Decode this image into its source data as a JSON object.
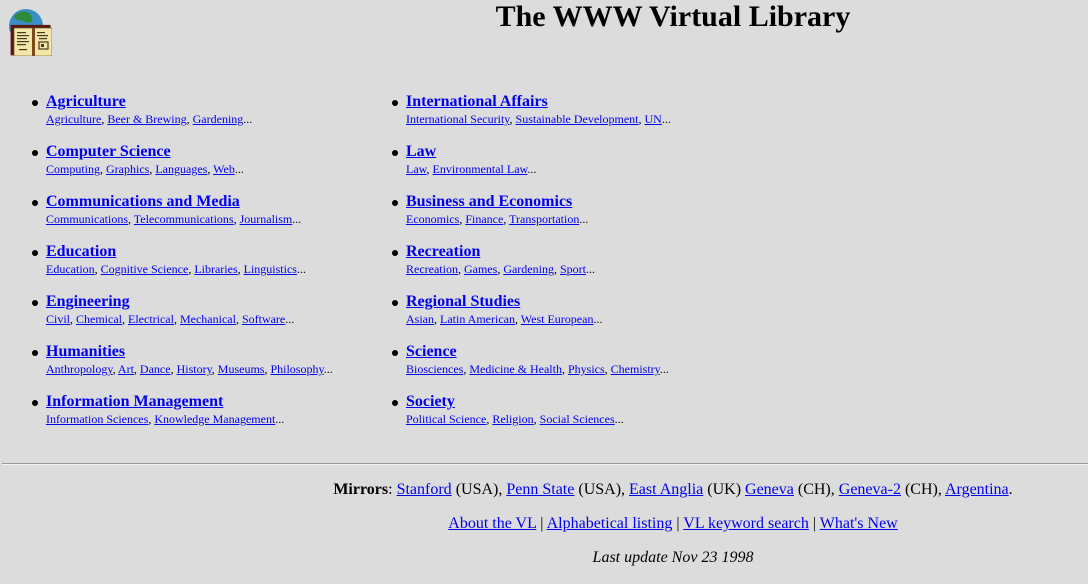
{
  "header": {
    "logo_icon": "globe-book-icon",
    "title": "The WWW Virtual Library"
  },
  "left_column": [
    {
      "title": "Agriculture",
      "subs": [
        "Agriculture",
        "Beer & Brewing",
        "Gardening"
      ]
    },
    {
      "title": "Computer Science",
      "subs": [
        "Computing",
        "Graphics",
        "Languages",
        "Web"
      ]
    },
    {
      "title": "Communications and Media",
      "subs": [
        "Communications",
        "Telecommunications",
        "Journalism"
      ]
    },
    {
      "title": "Education",
      "subs": [
        "Education",
        "Cognitive Science",
        "Libraries",
        "Linguistics"
      ]
    },
    {
      "title": "Engineering",
      "subs": [
        "Civil",
        "Chemical",
        "Electrical",
        "Mechanical",
        "Software"
      ]
    },
    {
      "title": "Humanities",
      "subs": [
        "Anthropology",
        "Art",
        "Dance",
        "History",
        "Museums",
        "Philosophy"
      ]
    },
    {
      "title": "Information Management",
      "subs": [
        "Information Sciences",
        "Knowledge Management"
      ]
    }
  ],
  "right_column": [
    {
      "title": "International Affairs",
      "subs": [
        "International Security",
        "Sustainable Development",
        "UN"
      ]
    },
    {
      "title": "Law",
      "subs": [
        "Law",
        "Environmental Law"
      ]
    },
    {
      "title": "Business and Economics",
      "subs": [
        "Economics",
        "Finance",
        "Transportation"
      ]
    },
    {
      "title": "Recreation",
      "subs": [
        "Recreation",
        "Games",
        "Gardening",
        "Sport"
      ]
    },
    {
      "title": "Regional Studies",
      "subs": [
        "Asian",
        "Latin American",
        "West European"
      ]
    },
    {
      "title": "Science",
      "subs": [
        "Biosciences",
        "Medicine & Health",
        "Physics",
        "Chemistry"
      ]
    },
    {
      "title": "Society",
      "subs": [
        "Political Science",
        "Religion",
        "Social Sciences"
      ]
    }
  ],
  "footer": {
    "mirrors_label": "Mirrors",
    "mirrors": [
      {
        "name": "Stanford",
        "country": "(USA)",
        "sep": ", "
      },
      {
        "name": "Penn State",
        "country": "(USA)",
        "sep": ", "
      },
      {
        "name": "East Anglia",
        "country": "(UK)",
        "sep": " "
      },
      {
        "name": "Geneva",
        "country": "(CH)",
        "sep": ", "
      },
      {
        "name": "Geneva-2",
        "country": "(CH)",
        "sep": ", "
      },
      {
        "name": "Argentina",
        "country": "",
        "sep": "."
      }
    ],
    "nav_links": [
      "About the VL",
      "Alphabetical listing",
      "VL keyword search",
      "What's New"
    ],
    "nav_separator": "|",
    "last_update": "Last update Nov 23 1998"
  },
  "colors": {
    "background": "#dcdcdc",
    "link": "#0000ee",
    "text": "#000000"
  }
}
